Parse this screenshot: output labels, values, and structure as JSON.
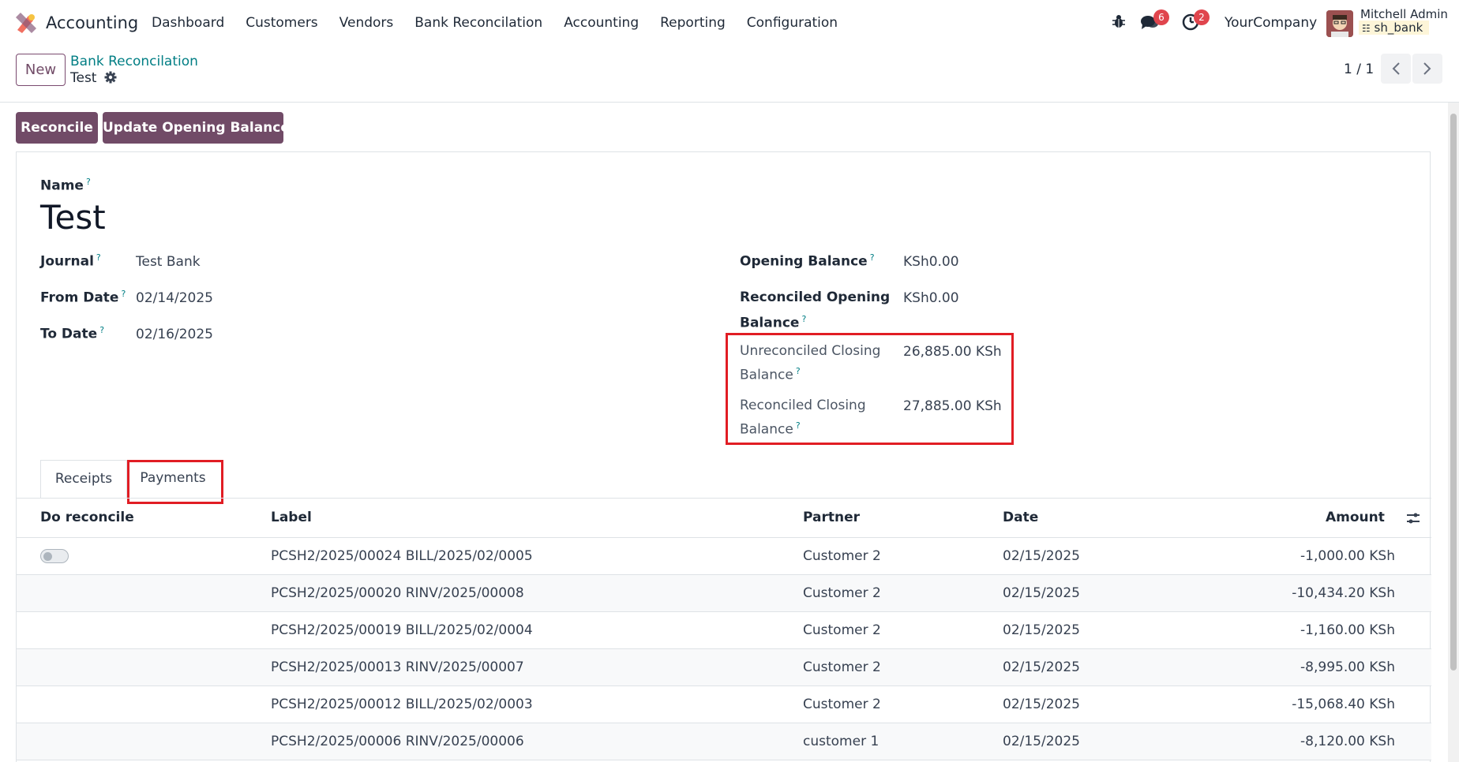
{
  "nav": {
    "app_name": "Accounting",
    "menu": [
      "Dashboard",
      "Customers",
      "Vendors",
      "Bank Reconcilation",
      "Accounting",
      "Reporting",
      "Configuration"
    ],
    "messages_count": "6",
    "activities_count": "2",
    "company": "YourCompany",
    "user_name": "Mitchell Admin",
    "db_name": "sh_bank"
  },
  "control_panel": {
    "new_label": "New",
    "breadcrumb_parent": "Bank Reconcilation",
    "breadcrumb_current": "Test",
    "pager": "1 / 1"
  },
  "actions": {
    "reconcile": "Reconcile",
    "update_opening_balance": "Update Opening Balance"
  },
  "form": {
    "name_label": "Name",
    "name_value": "Test",
    "journal_label": "Journal",
    "journal_value": "Test Bank",
    "from_date_label": "From Date",
    "from_date_value": "02/14/2025",
    "to_date_label": "To Date",
    "to_date_value": "02/16/2025",
    "opening_balance_label": "Opening Balance",
    "opening_balance_value": "KSh0.00",
    "reconciled_opening_label_1": "Reconciled Opening",
    "reconciled_opening_label_2": "Balance",
    "reconciled_opening_value": "KSh0.00",
    "unreconciled_closing_label_1": "Unreconciled Closing",
    "unreconciled_closing_label_2": "Balance",
    "unreconciled_closing_value": "26,885.00 KSh",
    "reconciled_closing_label_1": "Reconciled Closing",
    "reconciled_closing_label_2": "Balance",
    "reconciled_closing_value": "27,885.00 KSh",
    "help_mark": "?"
  },
  "tabs": [
    "Receipts",
    "Payments"
  ],
  "table": {
    "columns": [
      "Do reconcile",
      "Label",
      "Partner",
      "Date",
      "Amount"
    ],
    "rows": [
      {
        "label": "PCSH2/2025/00024 BILL/2025/02/0005",
        "partner": "Customer 2",
        "date": "02/15/2025",
        "amount": "-1,000.00 KSh"
      },
      {
        "label": "PCSH2/2025/00020 RINV/2025/00008",
        "partner": "Customer 2",
        "date": "02/15/2025",
        "amount": "-10,434.20 KSh"
      },
      {
        "label": "PCSH2/2025/00019 BILL/2025/02/0004",
        "partner": "Customer 2",
        "date": "02/15/2025",
        "amount": "-1,160.00 KSh"
      },
      {
        "label": "PCSH2/2025/00013 RINV/2025/00007",
        "partner": "Customer 2",
        "date": "02/15/2025",
        "amount": "-8,995.00 KSh"
      },
      {
        "label": "PCSH2/2025/00012 BILL/2025/02/0003",
        "partner": "Customer 2",
        "date": "02/15/2025",
        "amount": "-15,068.40 KSh"
      },
      {
        "label": "PCSH2/2025/00006 RINV/2025/00006",
        "partner": "customer 1",
        "date": "02/15/2025",
        "amount": "-8,120.00 KSh"
      }
    ]
  },
  "colors": {
    "primary": "#714b67",
    "link": "#017e84",
    "highlight": "#e11d24",
    "badge": "#e0454d"
  }
}
